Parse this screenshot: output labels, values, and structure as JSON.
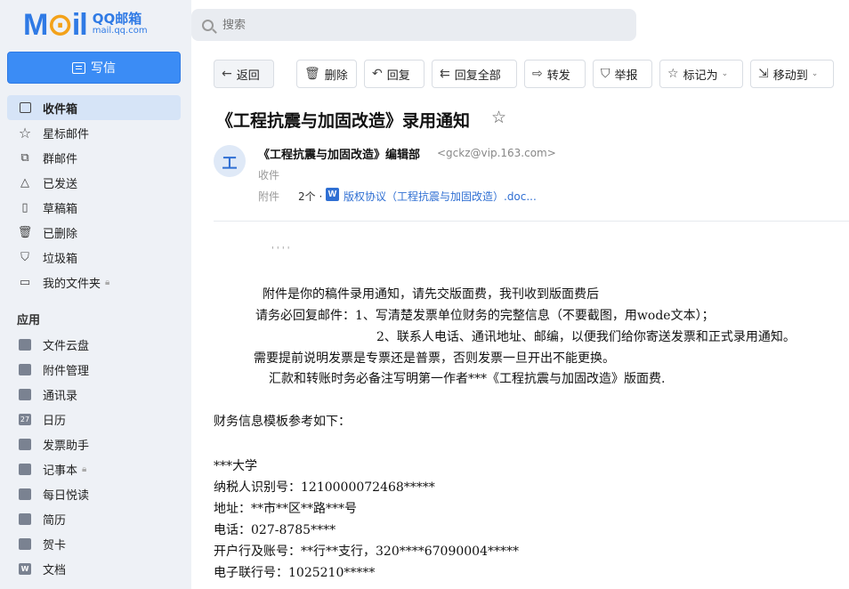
{
  "logo": {
    "word_pre": "M",
    "word_o": "⊙",
    "word_post": "il",
    "cn": "QQ邮箱",
    "en": "mail.qq.com"
  },
  "compose_label": "写信",
  "nav": [
    {
      "label": "收件箱",
      "icon": "inbox-icon"
    },
    {
      "label": "星标邮件",
      "icon": "star-icon"
    },
    {
      "label": "群邮件",
      "icon": "group-mail-icon"
    },
    {
      "label": "已发送",
      "icon": "sent-icon"
    },
    {
      "label": "草稿箱",
      "icon": "draft-icon"
    },
    {
      "label": "已删除",
      "icon": "trash-icon"
    },
    {
      "label": "垃圾箱",
      "icon": "spam-icon"
    },
    {
      "label": "我的文件夹",
      "icon": "folder-icon"
    }
  ],
  "apps_heading": "应用",
  "apps": [
    {
      "label": "文件云盘",
      "icon": "cloud-drive-icon"
    },
    {
      "label": "附件管理",
      "icon": "attachment-manager-icon"
    },
    {
      "label": "通讯录",
      "icon": "contacts-icon"
    },
    {
      "label": "日历",
      "icon": "calendar-icon",
      "glyph": "27"
    },
    {
      "label": "发票助手",
      "icon": "invoice-icon"
    },
    {
      "label": "记事本",
      "icon": "notepad-icon"
    },
    {
      "label": "每日悦读",
      "icon": "daily-reading-icon"
    },
    {
      "label": "简历",
      "icon": "resume-icon"
    },
    {
      "label": "贺卡",
      "icon": "greeting-card-icon"
    },
    {
      "label": "文档",
      "icon": "docs-icon",
      "glyph": "W"
    }
  ],
  "search_placeholder": "搜索",
  "toolbar": {
    "back": "返回",
    "delete": "删除",
    "reply": "回复",
    "reply_all": "回复全部",
    "forward": "转发",
    "report": "举报",
    "mark_as": "标记为",
    "move_to": "移动到"
  },
  "mail": {
    "subject": "《工程抗震与加固改造》录用通知",
    "avatar_letter": "工",
    "sender_name": "《工程抗震与加固改造》编辑部",
    "sender_email": "<gckz@vip.163.com>",
    "to_label": "收件",
    "attach_label": "附件",
    "attach_count": "2个 ·",
    "attach_name": "版权协议（工程抗震与加固改造）.doc..."
  },
  "body": {
    "line1": "附件是你的稿件录用通知，请先交版面费，我刊收到版面费后",
    "line2": "请务必回复邮件：1、写清楚发票单位财务的完整信息（不要截图，用wode文本）；",
    "line3": "2、联系人电话、通讯地址、邮编，以便我们给你寄送发票和正式录用通知。",
    "line4": "需要提前说明发票是专票还是普票，否则发票一旦开出不能更换。",
    "line5": "汇款和转账时务必备注写明第一作者***《工程抗震与加固改造》版面费.",
    "line6": "财务信息模板参考如下：",
    "line7": "***大学",
    "line8": "纳税人识别号：1210000072468*****",
    "line9": "地址：**市**区**路***号",
    "line10": "电话：027-8785****",
    "line11": "开户行及账号：**行**支行，320****67090004*****",
    "line12": "电子联行号：1025210*****"
  },
  "colors": {
    "accent": "#3b8cf5",
    "sidebar_bg": "#eef1f6",
    "active_bg": "#d6e4f7",
    "link": "#2f6fd3"
  }
}
